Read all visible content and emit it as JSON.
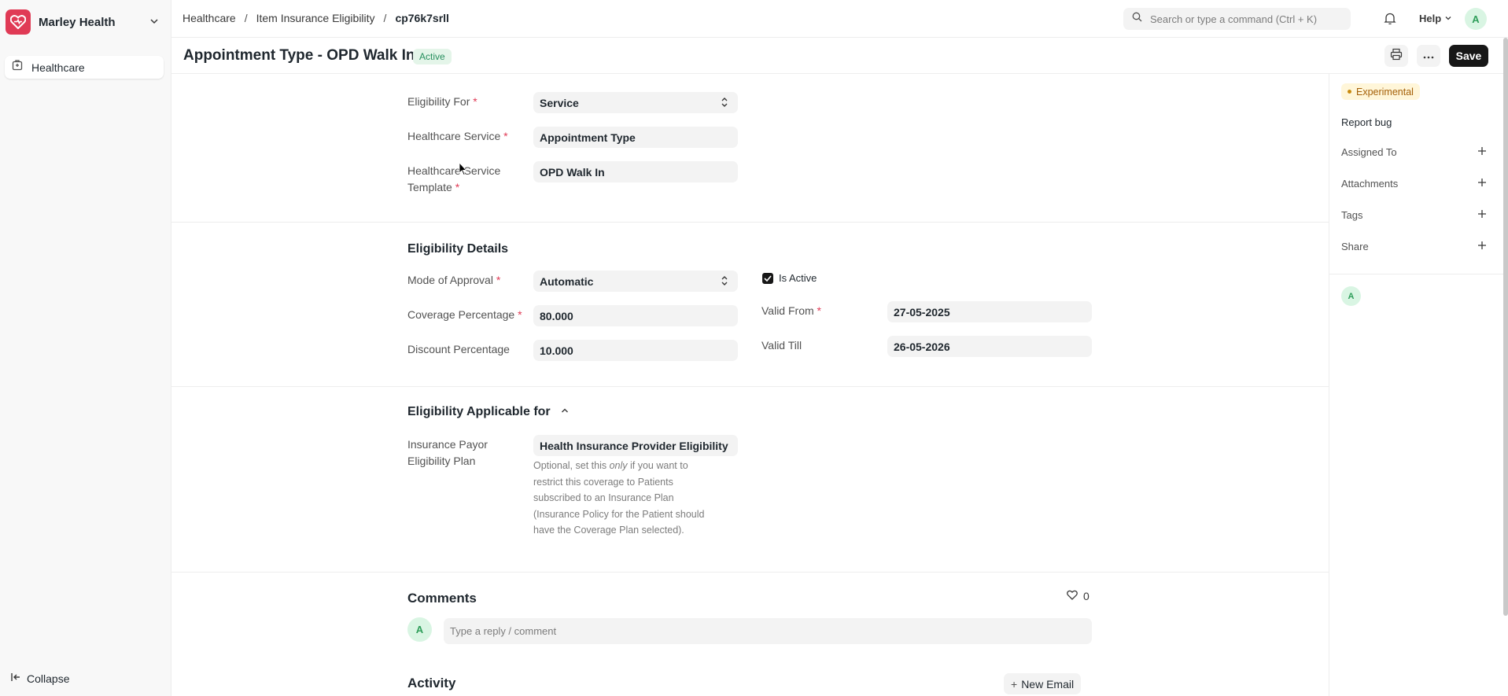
{
  "sidebar": {
    "brand_name": "Marley Health",
    "items": [
      {
        "label": "Healthcare",
        "icon": "hospital-icon"
      }
    ],
    "collapse_label": "Collapse"
  },
  "topbar": {
    "breadcrumbs": [
      "Healthcare",
      "Item Insurance Eligibility",
      "cp76k7srll"
    ],
    "search_placeholder": "Search or type a command (Ctrl + K)",
    "help_label": "Help",
    "avatar_initial": "A"
  },
  "page": {
    "title": "Appointment Type - OPD Walk In",
    "status": "Active",
    "save_label": "Save"
  },
  "form": {
    "eligibility_for": {
      "label": "Eligibility For",
      "value": "Service"
    },
    "healthcare_service": {
      "label": "Healthcare Service",
      "value": "Appointment Type"
    },
    "service_template": {
      "label_line1": "Healthcare Service",
      "label_line2": "Template",
      "value": "OPD Walk In"
    },
    "details_title": "Eligibility Details",
    "mode_of_approval": {
      "label": "Mode of Approval",
      "value": "Automatic"
    },
    "coverage_percentage": {
      "label": "Coverage Percentage",
      "value": "80.000"
    },
    "discount_percentage": {
      "label": "Discount Percentage",
      "value": "10.000"
    },
    "is_active": {
      "label": "Is Active",
      "checked": true
    },
    "valid_from": {
      "label": "Valid From",
      "value": "27-05-2025"
    },
    "valid_till": {
      "label": "Valid Till",
      "value": "26-05-2026"
    },
    "applicable_title": "Eligibility Applicable for",
    "payor_plan": {
      "label_line1": "Insurance Payor",
      "label_line2": "Eligibility Plan",
      "value": "Health Insurance Provider Eligibility",
      "help_before": "Optional, set this ",
      "help_em": "only",
      "help_after": " if you want to restrict this coverage to Patients subscribed to an Insurance Plan (Insurance Policy for the Patient should have the Coverage Plan selected)."
    }
  },
  "comments": {
    "title": "Comments",
    "likes": "0",
    "avatar_initial": "A",
    "placeholder": "Type a reply / comment"
  },
  "activity": {
    "title": "Activity",
    "new_email_label": "New Email"
  },
  "rightbar": {
    "badge": "Experimental",
    "report_bug": "Report bug",
    "rows": [
      "Assigned To",
      "Attachments",
      "Tags",
      "Share"
    ],
    "avatar_initial": "A"
  },
  "colors": {
    "brand": "#e03a55",
    "save_bg": "#171717",
    "active_pill_bg": "#e4f5e9",
    "active_pill_text": "#278f5e",
    "experimental_bg": "#fff6d9",
    "experimental_text": "#a56008"
  }
}
